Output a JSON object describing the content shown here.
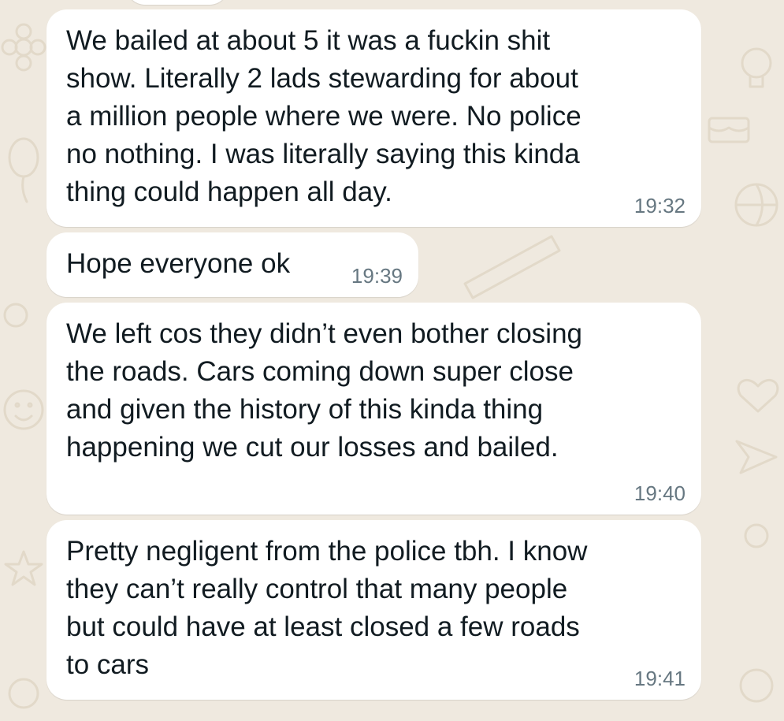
{
  "colors": {
    "wallpaper": "#efe9df",
    "wallpaper_doodle": "#e2d9c9",
    "bubble": "#ffffff",
    "message_text": "#111b21",
    "timestamp": "#667781"
  },
  "wallpaper_doodles": [
    "emoji-icon",
    "heart-icon",
    "star-icon",
    "lightbulb-icon",
    "cake-icon",
    "ball-icon",
    "balloon-icon",
    "paper-plane-icon"
  ],
  "messages": [
    {
      "text": "We bailed at about 5 it was a fuckin shit\nshow. Literally 2 lads stewarding for about\na million people where we were. No police\nno nothing. I was literally saying this kinda\nthing could happen all day.",
      "time": "19:32"
    },
    {
      "text": "Hope everyone ok",
      "time": "19:39"
    },
    {
      "text": "We left cos they didn’t even bother closing\nthe roads. Cars coming down super close\nand given the history of this kinda thing\nhappening we cut our losses and bailed.",
      "time": "19:40"
    },
    {
      "text": "Pretty negligent from the police tbh. I know\nthey can’t really control that many people\nbut could have at least closed a few roads\nto cars",
      "time": "19:41"
    }
  ]
}
